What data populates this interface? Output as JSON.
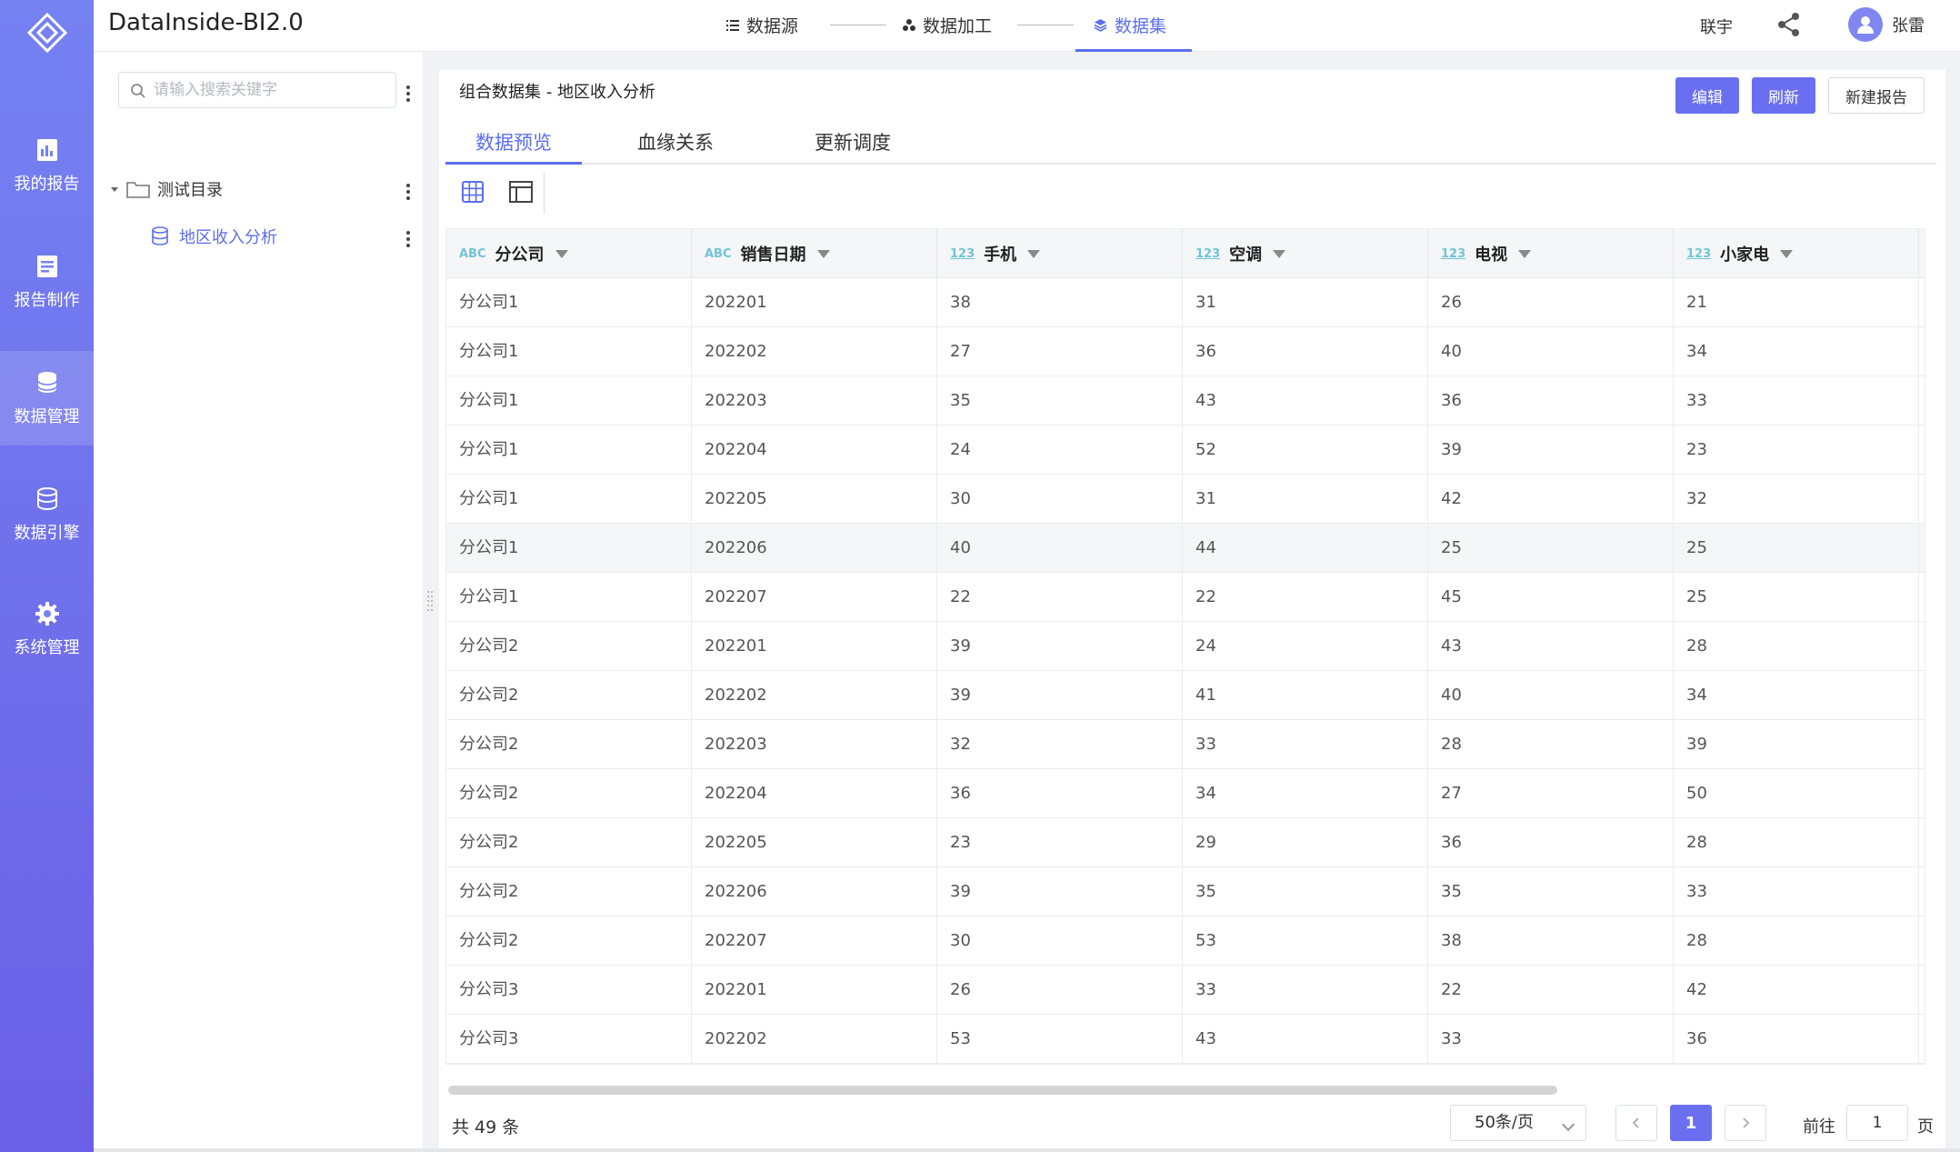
{
  "app": {
    "title": "DataInside-BI2.0"
  },
  "sidebar": {
    "items": [
      {
        "label": "我的报告",
        "icon": "report-icon"
      },
      {
        "label": "报告制作",
        "icon": "report-edit-icon"
      },
      {
        "label": "数据管理",
        "icon": "database-icon",
        "active": true
      },
      {
        "label": "数据引擎",
        "icon": "engine-icon"
      },
      {
        "label": "系统管理",
        "icon": "gear-icon"
      }
    ]
  },
  "header": {
    "steps": [
      {
        "label": "数据源",
        "icon": "list-icon"
      },
      {
        "label": "数据加工",
        "icon": "process-icon"
      },
      {
        "label": "数据集",
        "icon": "layers-icon",
        "active": true
      }
    ],
    "link": "联宇",
    "user": "张雷"
  },
  "tree": {
    "search_placeholder": "请输入搜索关键字",
    "folder": "测试目录",
    "leaf": "地区收入分析"
  },
  "main": {
    "breadcrumb": "组合数据集 - 地区收入分析",
    "buttons": {
      "edit": "编辑",
      "refresh": "刷新",
      "new_report": "新建报告"
    },
    "tabs": [
      "数据预览",
      "血缘关系",
      "更新调度"
    ],
    "active_tab": 0
  },
  "table": {
    "columns": [
      {
        "name": "分公司",
        "type": "ABC"
      },
      {
        "name": "销售日期",
        "type": "ABC"
      },
      {
        "name": "手机",
        "type": "123"
      },
      {
        "name": "空调",
        "type": "123"
      },
      {
        "name": "电视",
        "type": "123"
      },
      {
        "name": "小家电",
        "type": "123"
      }
    ],
    "rows": [
      [
        "分公司1",
        "202201",
        "38",
        "31",
        "26",
        "21"
      ],
      [
        "分公司1",
        "202202",
        "27",
        "36",
        "40",
        "34"
      ],
      [
        "分公司1",
        "202203",
        "35",
        "43",
        "36",
        "33"
      ],
      [
        "分公司1",
        "202204",
        "24",
        "52",
        "39",
        "23"
      ],
      [
        "分公司1",
        "202205",
        "30",
        "31",
        "42",
        "32"
      ],
      [
        "分公司1",
        "202206",
        "40",
        "44",
        "25",
        "25"
      ],
      [
        "分公司1",
        "202207",
        "22",
        "22",
        "45",
        "25"
      ],
      [
        "分公司2",
        "202201",
        "39",
        "24",
        "43",
        "28"
      ],
      [
        "分公司2",
        "202202",
        "39",
        "41",
        "40",
        "34"
      ],
      [
        "分公司2",
        "202203",
        "32",
        "33",
        "28",
        "39"
      ],
      [
        "分公司2",
        "202204",
        "36",
        "34",
        "27",
        "50"
      ],
      [
        "分公司2",
        "202205",
        "23",
        "29",
        "36",
        "28"
      ],
      [
        "分公司2",
        "202206",
        "39",
        "35",
        "35",
        "33"
      ],
      [
        "分公司2",
        "202207",
        "30",
        "53",
        "38",
        "28"
      ],
      [
        "分公司3",
        "202201",
        "26",
        "33",
        "22",
        "42"
      ],
      [
        "分公司3",
        "202202",
        "53",
        "43",
        "33",
        "36"
      ]
    ],
    "highlighted_row": 5
  },
  "pagination": {
    "total": "共 49 条",
    "page_size": "50条/页",
    "current_page": "1",
    "goto_label": "前往",
    "goto_value": "1",
    "page_suffix": "页"
  },
  "colors": {
    "accent": "#5b6ef0",
    "sidebar": "#7582f2",
    "button": "#6a6ff2"
  }
}
